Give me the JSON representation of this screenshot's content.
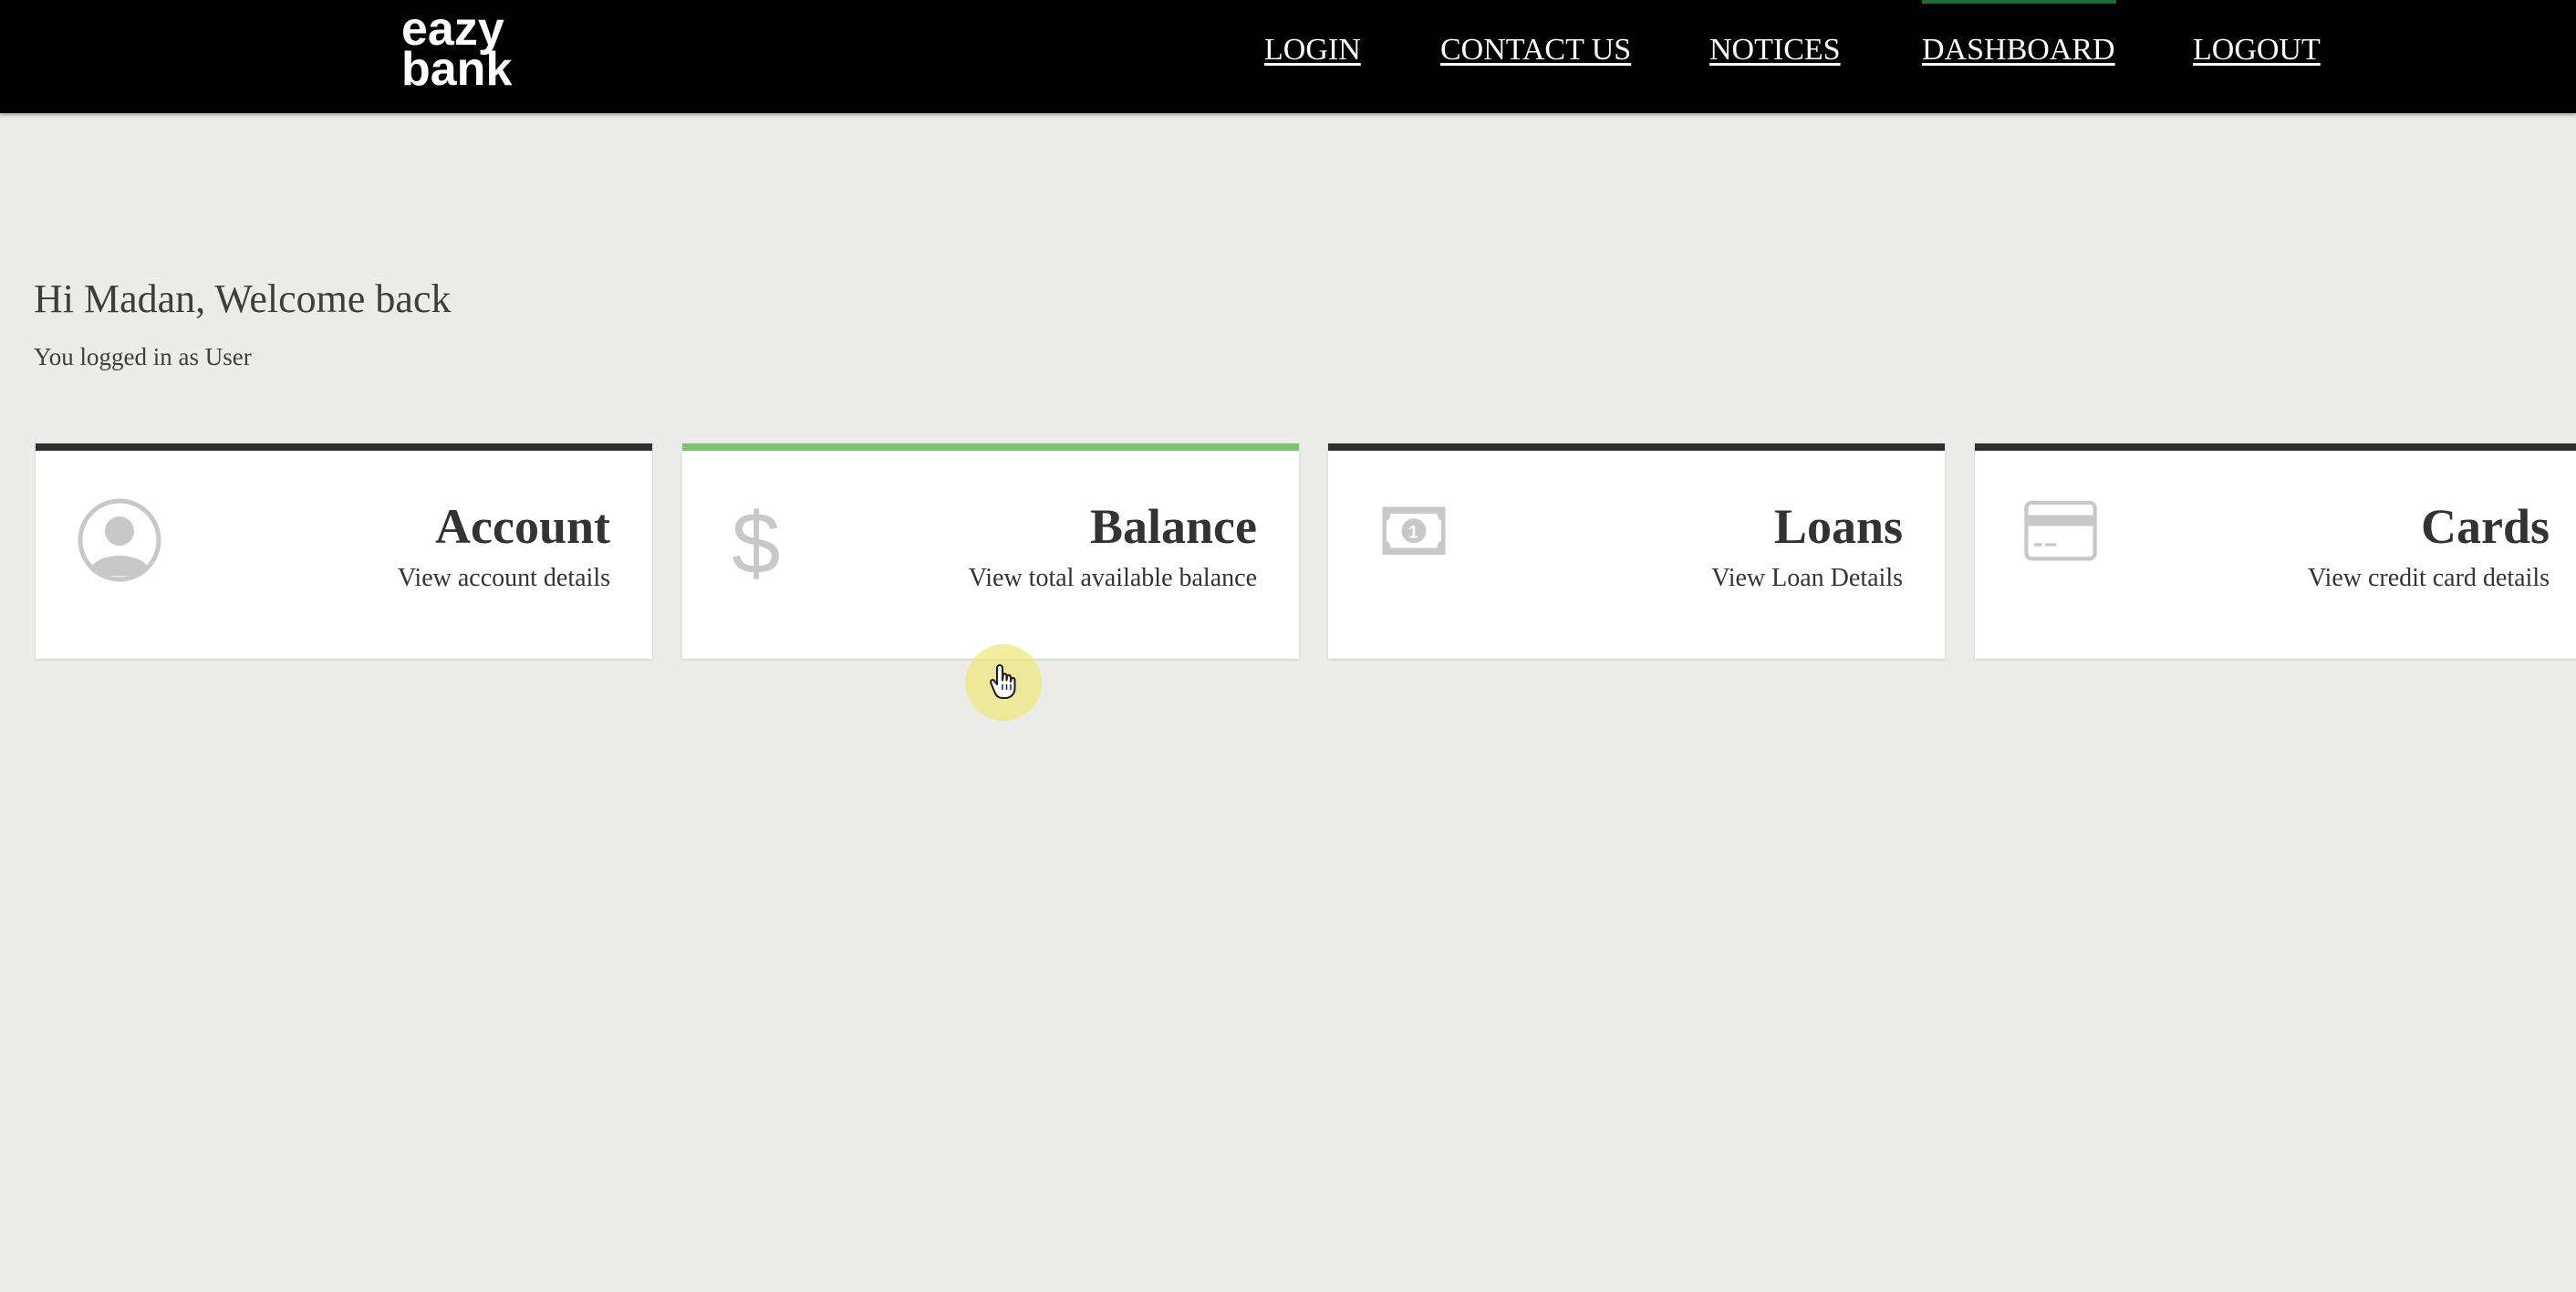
{
  "brand": {
    "logo_line1": "eazy",
    "logo_line2": "bank"
  },
  "nav": {
    "items": [
      {
        "label": "LOGIN"
      },
      {
        "label": "CONTACT US"
      },
      {
        "label": "NOTICES"
      },
      {
        "label": "DASHBOARD",
        "active": true
      },
      {
        "label": "LOGOUT"
      }
    ]
  },
  "welcome": {
    "greeting": "Hi Madan, Welcome back",
    "role_text": "You logged in as User"
  },
  "cards": [
    {
      "title": "Account",
      "description": "View account details",
      "icon": "user-icon"
    },
    {
      "title": "Balance",
      "description": "View total available balance",
      "icon": "dollar-icon",
      "active": true
    },
    {
      "title": "Loans",
      "description": "View Loan Details",
      "icon": "money-bill-icon"
    },
    {
      "title": "Cards",
      "description": "View credit card details",
      "icon": "credit-card-icon"
    }
  ],
  "colors": {
    "header_bg": "#020202",
    "page_bg": "#ececea",
    "card_border_default": "#2f2f33",
    "card_border_active": "#7dc26f",
    "icon_gray": "#c8c8c8",
    "text_dark": "#333333"
  }
}
